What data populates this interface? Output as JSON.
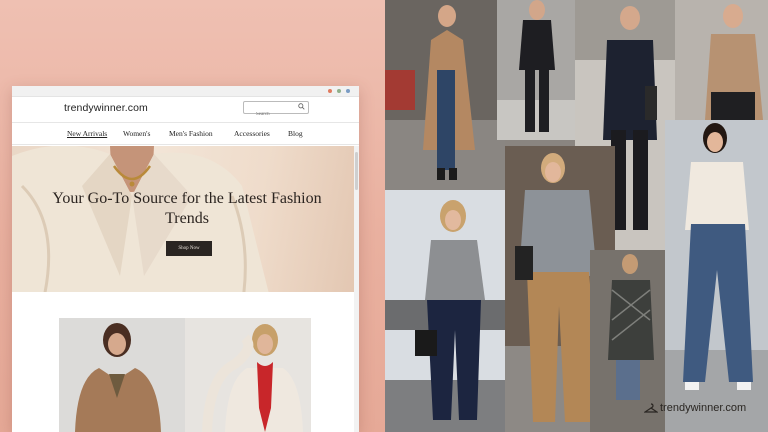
{
  "site": {
    "logo": "trendywinner.com",
    "search_placeholder": "Search",
    "nav": [
      "New Arrivals",
      "Women's",
      "Men's Fashion",
      "Accessories",
      "Blog"
    ],
    "active_nav_index": 0
  },
  "hero": {
    "title": "Your Go-To Source for the Latest Fashion Trends",
    "cta_label": "Shop Now"
  },
  "watermark": "trendywinner.com",
  "colors": {
    "background_pink": "#eab5a4",
    "button_dark": "#2a2522",
    "window_dots": [
      "#e07b5f",
      "#8fb08a",
      "#7a9cc4"
    ]
  },
  "icons": [
    "search-icon",
    "hanger-icon"
  ]
}
